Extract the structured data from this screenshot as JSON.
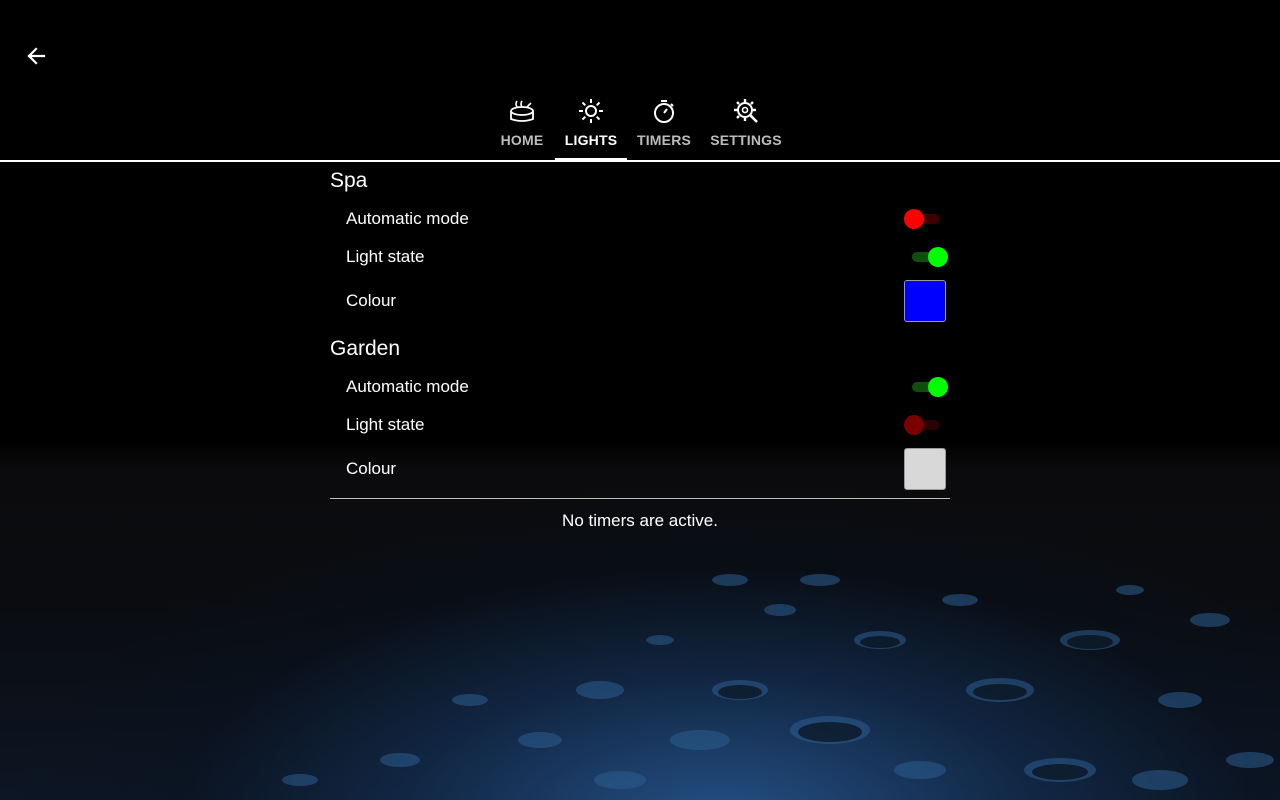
{
  "nav": {
    "back_icon": "arrow-left-icon"
  },
  "tabs": [
    {
      "label": "HOME",
      "icon": "hot-tub-icon",
      "active": false
    },
    {
      "label": "LIGHTS",
      "icon": "sun-icon",
      "active": true
    },
    {
      "label": "TIMERS",
      "icon": "stopwatch-icon",
      "active": false
    },
    {
      "label": "SETTINGS",
      "icon": "gear-wrench-icon",
      "active": false
    }
  ],
  "groups": [
    {
      "title": "Spa",
      "automatic_mode": {
        "label": "Automatic mode",
        "state": "off",
        "color": "#ff0000"
      },
      "light_state": {
        "label": "Light state",
        "state": "on",
        "color": "#00ff00"
      },
      "colour": {
        "label": "Colour",
        "value": "#0000ff"
      }
    },
    {
      "title": "Garden",
      "automatic_mode": {
        "label": "Automatic mode",
        "state": "on",
        "color": "#00ff00"
      },
      "light_state": {
        "label": "Light state",
        "state": "off",
        "color": "#7a0000"
      },
      "colour": {
        "label": "Colour",
        "value": "#d8d8d8"
      }
    }
  ],
  "timers": {
    "status": "No timers are active."
  },
  "colors": {
    "tab_active": "#ffffff",
    "tab_inactive": "#bdbdbd",
    "on_thumb": "#00ff00",
    "on_track": "#0d4f0d",
    "off_thumb_red": "#ff0000",
    "off_track_red": "#3d0000"
  }
}
